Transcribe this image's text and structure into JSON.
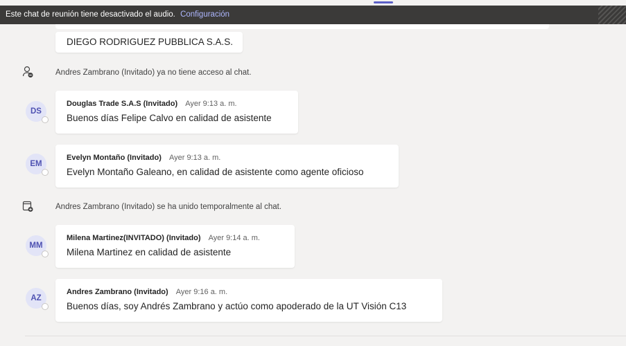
{
  "banner": {
    "message": "Este chat de reunión tiene desactivado el audio.",
    "link": "Configuración"
  },
  "messages": [
    {
      "text": "DIEGO RODRIGUEZ PUBBLICA S.A.S."
    },
    {
      "system": true,
      "icon": "person-remove-icon",
      "text": "Andres Zambrano (Invitado) ya no tiene acceso al chat."
    },
    {
      "initials": "DS",
      "author": "Douglas Trade S.A.S (Invitado)",
      "time": "Ayer 9:13 a. m.",
      "text": "Buenos días Felipe Calvo en calidad de asistente"
    },
    {
      "initials": "EM",
      "author": "Evelyn Montaño (Invitado)",
      "time": "Ayer 9:13 a. m.",
      "text": "Evelyn Montaño Galeano, en calidad de asistente como agente oficioso"
    },
    {
      "system": true,
      "icon": "chat-add-icon",
      "text": "Andres Zambrano (Invitado) se ha unido temporalmente al chat."
    },
    {
      "initials": "MM",
      "author": "Milena Martinez(INVITADO) (Invitado)",
      "time": "Ayer 9:14 a. m.",
      "text": "Milena Martinez  en calidad de  asistente"
    },
    {
      "initials": "AZ",
      "author": "Andres Zambrano (Invitado)",
      "time": "Ayer 9:16 a. m.",
      "text": "Buenos días, soy Andrés Zambrano y actúo como apoderado de la UT Visión C13"
    }
  ],
  "colors": {
    "background": "#f3f2f1",
    "banner": "#3b3a39",
    "link": "#aeb7ff",
    "accent": "#5b5fc7",
    "avatar_bg": "#e2e4f7",
    "avatar_text": "#4f52b2"
  }
}
